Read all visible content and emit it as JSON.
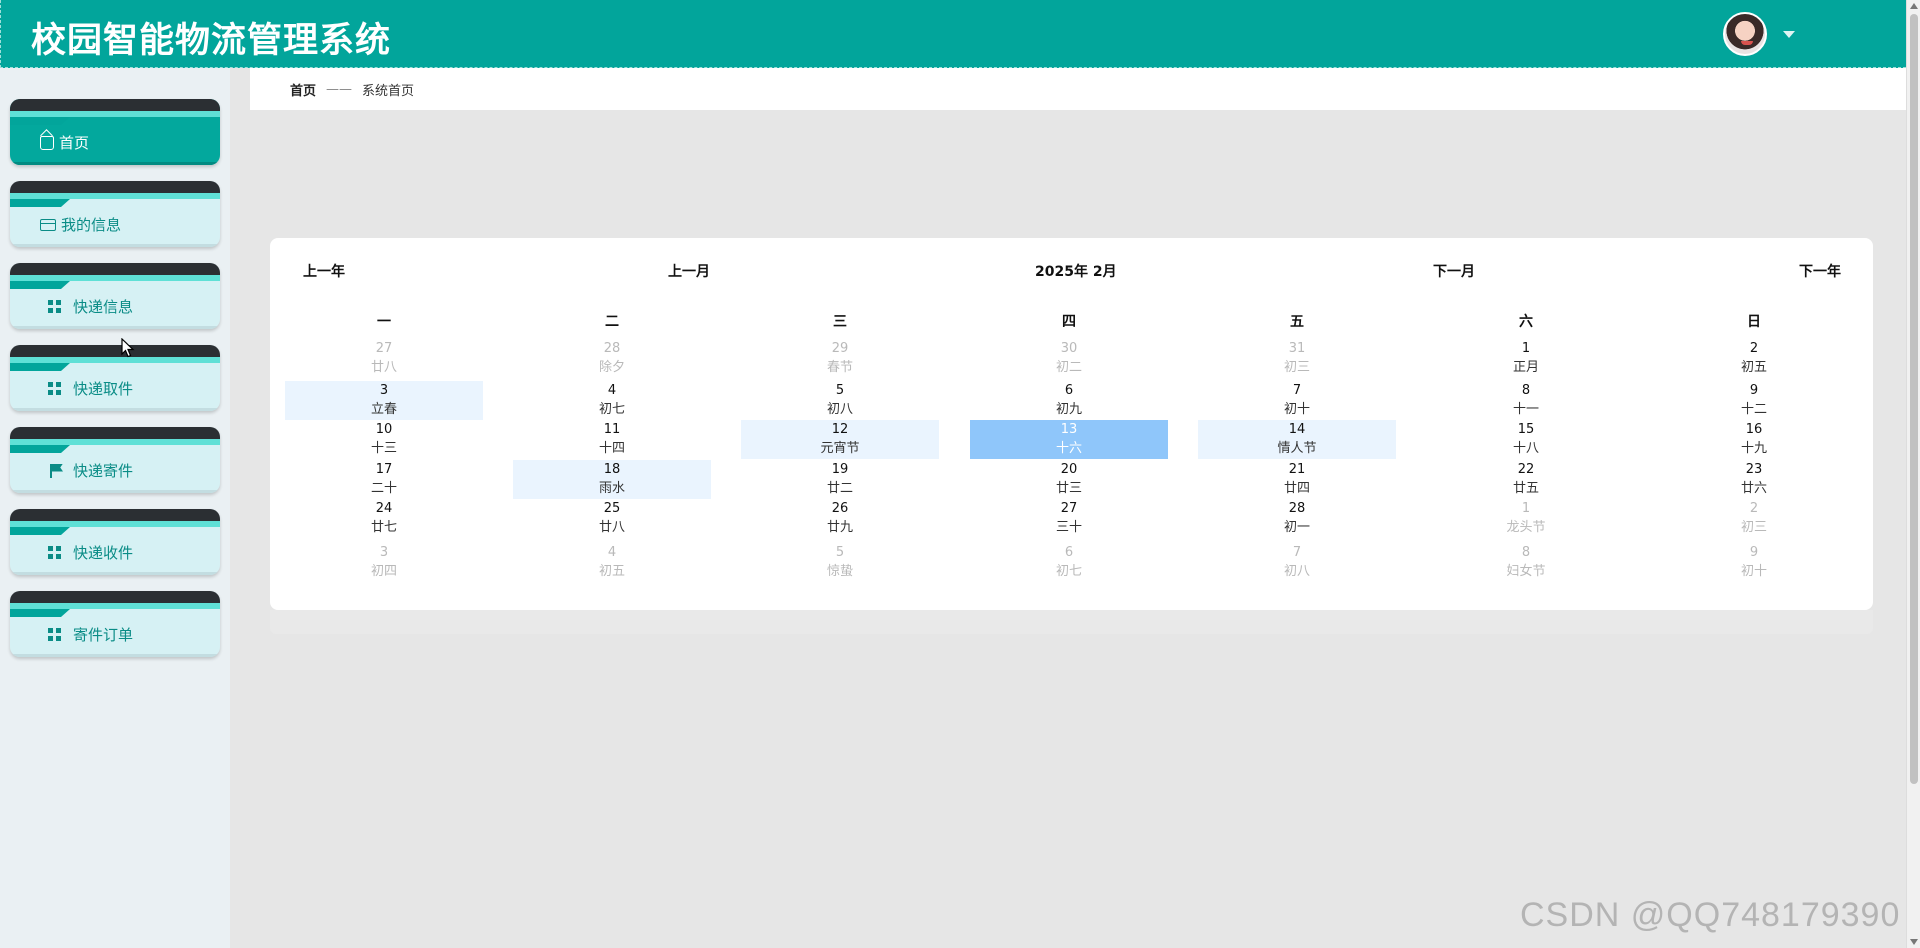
{
  "header": {
    "title": "校园智能物流管理系统",
    "avatar_icon": "user-avatar",
    "dropdown_icon": "caret-down-icon"
  },
  "sidebar": {
    "items": [
      {
        "label": "首页",
        "icon": "home-icon",
        "active": true
      },
      {
        "label": "我的信息",
        "icon": "id-card-icon",
        "active": false
      },
      {
        "label": "快递信息",
        "icon": "grid-icon",
        "active": false
      },
      {
        "label": "快递取件",
        "icon": "grid-icon",
        "active": false
      },
      {
        "label": "快递寄件",
        "icon": "flag-icon",
        "active": false
      },
      {
        "label": "快递收件",
        "icon": "grid-icon",
        "active": false
      },
      {
        "label": "寄件订单",
        "icon": "grid-icon",
        "active": false
      }
    ]
  },
  "breadcrumb": {
    "home": "首页",
    "separator": "——",
    "current": "系统首页"
  },
  "calendar": {
    "prev_year": "上一年",
    "prev_month": "上一月",
    "title": "2025年 2月",
    "next_month": "下一月",
    "next_year": "下一年",
    "weekdays": [
      "一",
      "二",
      "三",
      "四",
      "五",
      "六",
      "日"
    ],
    "weeks": [
      [
        {
          "day": "27",
          "lunar": "廿八",
          "muted": true
        },
        {
          "day": "28",
          "lunar": "除夕",
          "muted": true
        },
        {
          "day": "29",
          "lunar": "春节",
          "muted": true
        },
        {
          "day": "30",
          "lunar": "初二",
          "muted": true
        },
        {
          "day": "31",
          "lunar": "初三",
          "muted": true
        },
        {
          "day": "1",
          "lunar": "正月"
        },
        {
          "day": "2",
          "lunar": "初五"
        }
      ],
      [
        {
          "day": "3",
          "lunar": "立春",
          "highlight": true
        },
        {
          "day": "4",
          "lunar": "初七"
        },
        {
          "day": "5",
          "lunar": "初八"
        },
        {
          "day": "6",
          "lunar": "初九"
        },
        {
          "day": "7",
          "lunar": "初十"
        },
        {
          "day": "8",
          "lunar": "十一"
        },
        {
          "day": "9",
          "lunar": "十二"
        }
      ],
      [
        {
          "day": "10",
          "lunar": "十三"
        },
        {
          "day": "11",
          "lunar": "十四"
        },
        {
          "day": "12",
          "lunar": "元宵节",
          "highlight": true
        },
        {
          "day": "13",
          "lunar": "十六",
          "today": true
        },
        {
          "day": "14",
          "lunar": "情人节",
          "highlight": true
        },
        {
          "day": "15",
          "lunar": "十八"
        },
        {
          "day": "16",
          "lunar": "十九"
        }
      ],
      [
        {
          "day": "17",
          "lunar": "二十"
        },
        {
          "day": "18",
          "lunar": "雨水",
          "highlight": true
        },
        {
          "day": "19",
          "lunar": "廿二"
        },
        {
          "day": "20",
          "lunar": "廿三"
        },
        {
          "day": "21",
          "lunar": "廿四"
        },
        {
          "day": "22",
          "lunar": "廿五"
        },
        {
          "day": "23",
          "lunar": "廿六"
        }
      ],
      [
        {
          "day": "24",
          "lunar": "廿七"
        },
        {
          "day": "25",
          "lunar": "廿八"
        },
        {
          "day": "26",
          "lunar": "廿九"
        },
        {
          "day": "27",
          "lunar": "三十"
        },
        {
          "day": "28",
          "lunar": "初一"
        },
        {
          "day": "1",
          "lunar": "龙头节",
          "muted": true
        },
        {
          "day": "2",
          "lunar": "初三",
          "muted": true
        }
      ],
      [
        {
          "day": "3",
          "lunar": "初四",
          "muted": true
        },
        {
          "day": "4",
          "lunar": "初五",
          "muted": true
        },
        {
          "day": "5",
          "lunar": "惊蛰",
          "muted": true
        },
        {
          "day": "6",
          "lunar": "初七",
          "muted": true
        },
        {
          "day": "7",
          "lunar": "初八",
          "muted": true
        },
        {
          "day": "8",
          "lunar": "妇女节",
          "muted": true
        },
        {
          "day": "9",
          "lunar": "初十",
          "muted": true
        }
      ]
    ]
  },
  "watermark": "CSDN @QQ748179390",
  "colors": {
    "primary": "#02a59b",
    "menu_bg": "#d6f1f4",
    "today_bg": "#8fc6fa",
    "highlight_bg": "#eaf4fe"
  }
}
